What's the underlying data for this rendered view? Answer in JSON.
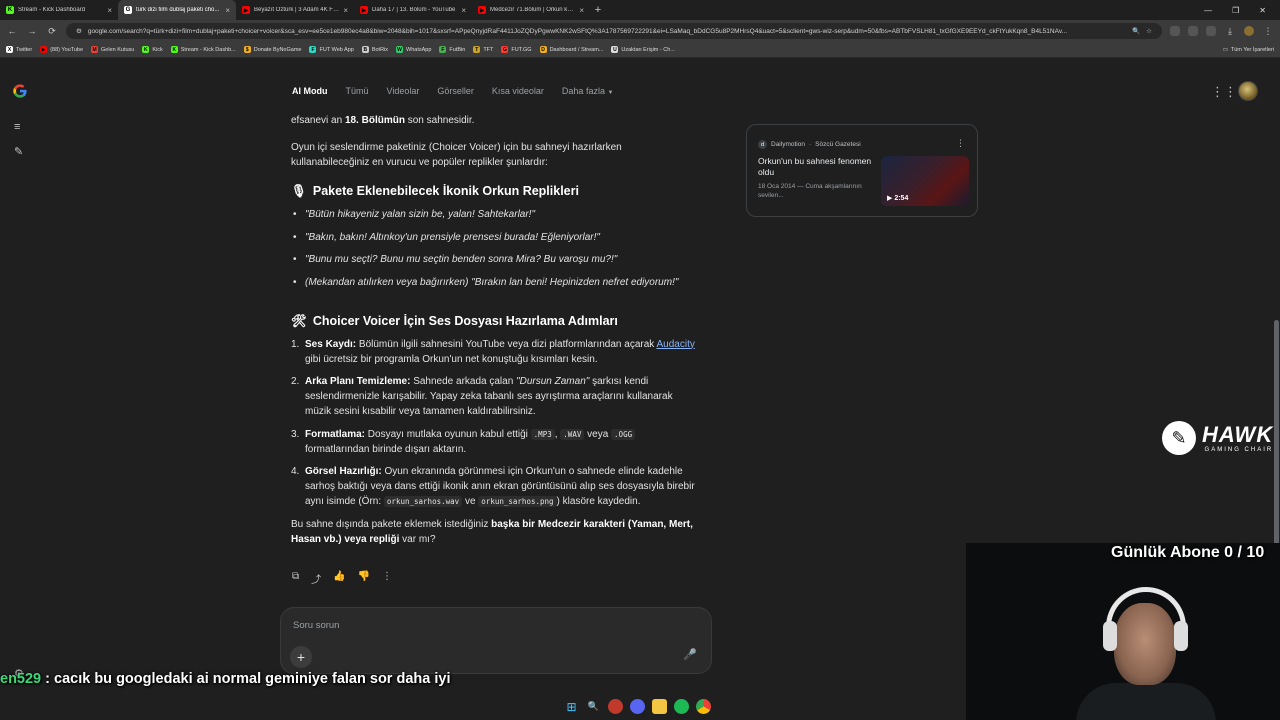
{
  "browser": {
    "tabs": [
      {
        "title": "Stream - Kick Dashboard",
        "favicon": "K",
        "color": "#53fc18",
        "active": false
      },
      {
        "title": "türk dizi film dublaj paketi cho...",
        "favicon": "G",
        "color": "#ffffff",
        "active": true
      },
      {
        "title": "Beyazıt Öztürk | 3 Adam 4K FU...",
        "favicon": "▶",
        "color": "#ff0000",
        "active": false
      },
      {
        "title": "Daha 17 | 13. Bölüm - YouTube",
        "favicon": "▶",
        "color": "#ff0000",
        "active": false
      },
      {
        "title": "Medcezir 71.Bölüm | Orkun kay...",
        "favicon": "▶",
        "color": "#ff0000",
        "active": false
      }
    ],
    "url": "google.com/search?q=türk+dizi+film+dublaj+paketi+choicer+voicer&sca_esv=ee5ce1eb980ec4a8&biw=2048&bih=1017&sxsrf=APpeQnyjdRaF4411JoZQDyPgwwKNK2wSFtQ%3A1787569722291&ei=LSaMaq_bDdCG5u8P2MHrsQ4&uact=5&sclient=gws-wiz-serp&udm=50&fbs=ABTbFVSLH81_txGfGXE9EEYd_ckFtYukKqn8_B4L51NAv...",
    "bookmarks": [
      {
        "label": "Twitter",
        "icon": "X",
        "color": "#ffffff"
      },
      {
        "label": "(88) YouTube",
        "icon": "▶",
        "color": "#ff0000"
      },
      {
        "label": "Gelen Kutusu",
        "icon": "M",
        "color": "#ea4335"
      },
      {
        "label": "Kick",
        "icon": "K",
        "color": "#53fc18"
      },
      {
        "label": "Stream - Kick Dashb...",
        "icon": "K",
        "color": "#53fc18"
      },
      {
        "label": "Donate ByNoGame",
        "icon": "$",
        "color": "#f2b01e"
      },
      {
        "label": "FUT Web App",
        "icon": "F",
        "color": "#2bd9c4"
      },
      {
        "label": "BotRix",
        "icon": "B",
        "color": "#cccccc"
      },
      {
        "label": "WhatsApp",
        "icon": "W",
        "color": "#25d366"
      },
      {
        "label": "FutBin",
        "icon": "F",
        "color": "#4caf50"
      },
      {
        "label": "TFT",
        "icon": "T",
        "color": "#c9a227"
      },
      {
        "label": "FUT.GG",
        "icon": "G",
        "color": "#ff3b30"
      },
      {
        "label": "Dashboard / Stream...",
        "icon": "D",
        "color": "#f2b01e"
      },
      {
        "label": "Uzaktan Erişim - Ch...",
        "icon": "U",
        "color": "#dddddd"
      }
    ],
    "bookmarks_right": "Tüm Yer İşaretleri"
  },
  "search_nav": {
    "items": [
      "AI Modu",
      "Tümü",
      "Videolar",
      "Görseller",
      "Kısa videolar",
      "Daha fazla"
    ]
  },
  "content": {
    "intro_pre": "efsanevi an ",
    "intro_bold": "18. Bölümün",
    "intro_post": " son sahnesidir.",
    "para2": "Oyun içi seslendirme paketiniz (Choicer Voicer) için bu sahneyi hazırlarken kullanabileceğiniz en vurucu ve popüler replikler şunlardır:",
    "h_quotes": "Pakete Eklenebilecek İkonik Orkun Replikleri",
    "quotes": [
      "\"Bütün hikayeniz yalan sizin be, yalan! Sahtekarlar!\"",
      "\"Bakın, bakın! Altınkoy'un prensiyle prensesi burada! Eğleniyorlar!\"",
      "\"Bunu mu seçti? Bunu mu seçtin benden sonra Mira? Bu varoşu mu?!\"",
      "(Mekandan atılırken veya bağırırken) \"Bırakın lan beni! Hepinizden nefret ediyorum!\""
    ],
    "h_steps": "Choicer Voicer İçin Ses Dosyası Hazırlama Adımları",
    "steps": [
      {
        "num": "1.",
        "title": "Ses Kaydı:",
        "pre": " Bölümün ilgili sahnesini YouTube veya dizi platformlarından açarak ",
        "link": "Audacity",
        "post": " gibi ücretsiz bir programla Orkun'un net konuştuğu kısımları kesin."
      },
      {
        "num": "2.",
        "title": "Arka Planı Temizleme:",
        "pre": " Sahnede arkada çalan ",
        "italic": "\"Dursun Zaman\"",
        "post": " şarkısı kendi seslendirmenizle karışabilir. Yapay zeka tabanlı ses ayrıştırma araçlarını kullanarak müzik sesini kısabilir veya tamamen kaldırabilirsiniz."
      },
      {
        "num": "3.",
        "title": "Formatlama:",
        "pre": " Dosyayı mutlaka oyunun kabul ettiği ",
        "code1": ".MP3",
        "mid1": ", ",
        "code2": ".WAV",
        "mid2": " veya ",
        "code3": ".OGG",
        "post": " formatlarından birinde dışarı aktarın."
      },
      {
        "num": "4.",
        "title": "Görsel Hazırlığı:",
        "pre": " Oyun ekranında görünmesi için Orkun'un o sahnede elinde kadehle sarhoş baktığı veya dans ettiği ikonik anın ekran görüntüsünü alıp ses dosyasıyla birebir aynı isimde (Örn: ",
        "code1": "orkun_sarhos.wav",
        "mid1": " ve ",
        "code2": "orkun_sarhos.png",
        "post": ") klasöre kaydedin."
      }
    ],
    "final_pre": "Bu sahne dışında pakete eklemek istediğiniz ",
    "final_bold": "başka bir Medcezir karakteri (Yaman, Mert, Hasan vb.) veya repliği",
    "final_post": " var mı?"
  },
  "ask": {
    "placeholder": "Soru sorun"
  },
  "card": {
    "source": "Dailymotion",
    "publisher": "Sözcü Gazetesi",
    "title": "Orkun'un bu sahnesi fenomen oldu",
    "date": "18 Oca 2014 — Cuma akşamlarının sevilen...",
    "duration": "2:54"
  },
  "overlay": {
    "hawk": "HAWK",
    "hawk_sub": "GAMING CHAIR",
    "abone": "Günlük Abone 0 / 10",
    "chat_user": "en529",
    "chat_msg": " : cacık bu googledaki ai normal geminiye falan sor daha iyi"
  }
}
